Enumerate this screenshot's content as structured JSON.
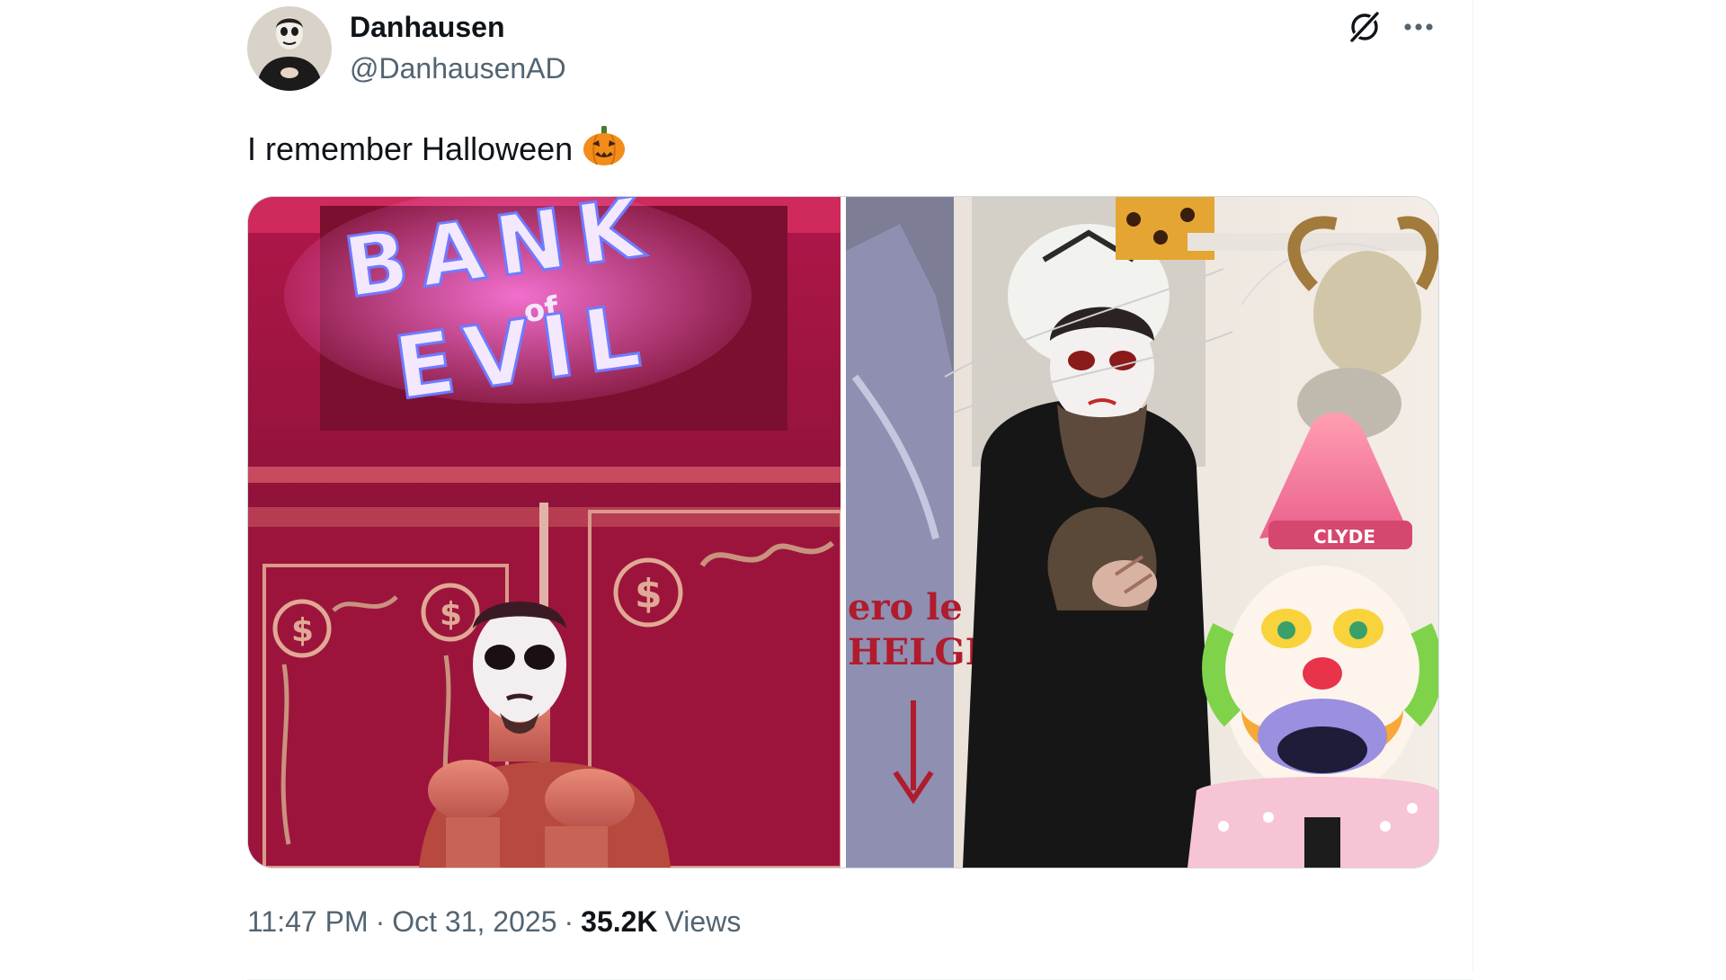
{
  "tweet": {
    "author": {
      "display_name": "Danhausen",
      "handle": "@DanhausenAD",
      "avatar_icon": "avatar"
    },
    "text": "I remember Halloween",
    "emoji": "🎃",
    "media": {
      "count": 2,
      "left_photo": {
        "sign_line1": "BANK",
        "sign_small": "of",
        "sign_line2": "EVIL"
      },
      "right_photo": {
        "clown_hat_text": "CLYDE"
      }
    },
    "timestamp": {
      "time": "11:47 PM",
      "date": "Oct 31, 2025"
    },
    "views": {
      "count": "35.2K",
      "label": "Views"
    },
    "icons": {
      "grok": "grok-icon",
      "more": "more-icon"
    },
    "colors": {
      "text_primary": "#0f1419",
      "text_secondary": "#536471",
      "border": "#cfd9de",
      "divider": "#eff3f4"
    }
  }
}
